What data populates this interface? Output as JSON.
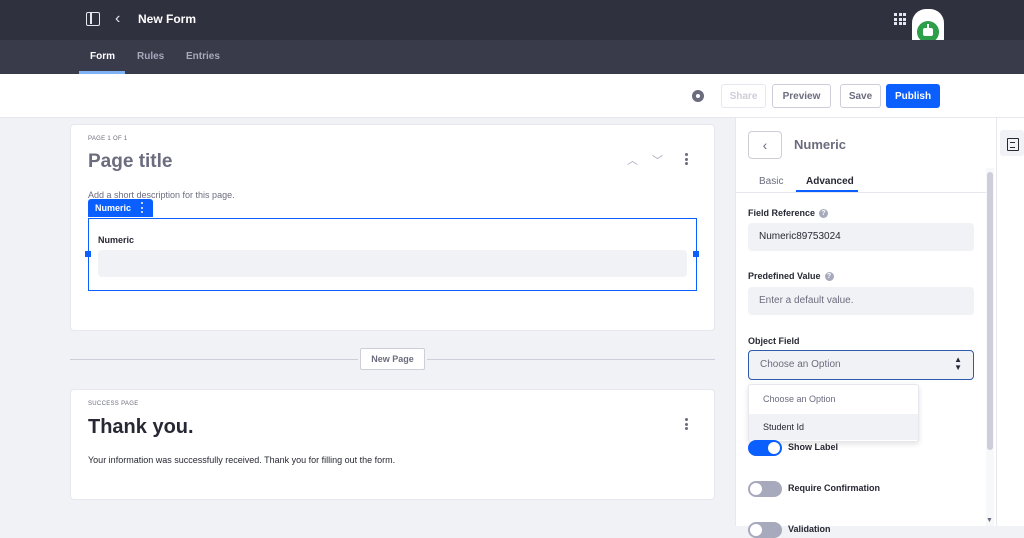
{
  "header": {
    "title": "New Form"
  },
  "nav": {
    "tabs": [
      {
        "label": "Form"
      },
      {
        "label": "Rules"
      },
      {
        "label": "Entries"
      }
    ]
  },
  "toolbar": {
    "share_label": "Share",
    "preview_label": "Preview",
    "save_label": "Save",
    "publish_label": "Publish"
  },
  "page": {
    "counter": "PAGE 1 OF 1",
    "title_placeholder": "Page title",
    "description_placeholder": "Add a short description for this page."
  },
  "field": {
    "tag_label": "Numeric",
    "label": "Numeric"
  },
  "new_page_label": "New Page",
  "success": {
    "caption": "SUCCESS PAGE",
    "title": "Thank you.",
    "body": "Your information was successfully received. Thank you for filling out the form."
  },
  "panel": {
    "title": "Numeric",
    "tabs": [
      {
        "label": "Basic"
      },
      {
        "label": "Advanced"
      }
    ],
    "field_reference_label": "Field Reference",
    "field_reference_value": "Numeric89753024",
    "predefined_value_label": "Predefined Value",
    "predefined_value_placeholder": "Enter a default value.",
    "object_field_label": "Object Field",
    "object_field_selected": "Choose an Option",
    "object_field_options": [
      {
        "label": "Choose an Option"
      },
      {
        "label": "Student Id"
      }
    ],
    "show_label": "Show Label",
    "require_confirmation": "Require Confirmation",
    "validation": "Validation"
  },
  "colors": {
    "primary": "#0b5fff",
    "topbar": "#30313f",
    "navbar": "#393a4a"
  }
}
